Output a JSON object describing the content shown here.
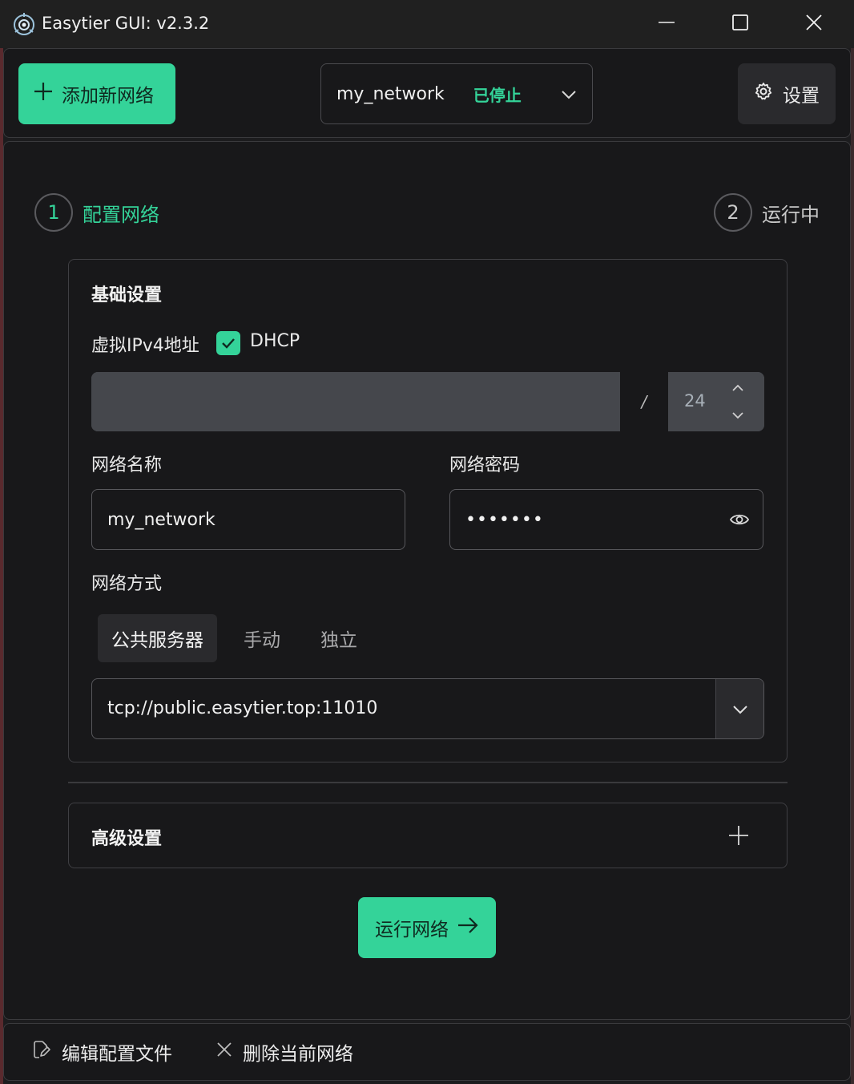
{
  "window": {
    "title": "Easytier GUI: v2.3.2",
    "controls": [
      "minimize-icon",
      "maximize-icon",
      "close-icon"
    ]
  },
  "toolbar": {
    "add_network_label": "添加新网络",
    "network_name": "my_network",
    "network_status": "已停止",
    "settings_label": "设置"
  },
  "steps": [
    {
      "number": "1",
      "label": "配置网络",
      "active": true
    },
    {
      "number": "2",
      "label": "运行中",
      "active": false
    }
  ],
  "basic": {
    "title": "基础设置",
    "virtual_ipv4_label": "虚拟IPv4地址",
    "dhcp_label": "DHCP",
    "dhcp_checked": true,
    "ipv4_value": "",
    "prefix_separator": "/",
    "prefix_value": "24",
    "network_name_label": "网络名称",
    "network_name_value": "my_network",
    "network_secret_label": "网络密码",
    "network_secret_value": "•••••••",
    "network_mode_label": "网络方式",
    "modes": [
      "公共服务器",
      "手动",
      "独立"
    ],
    "selected_mode": "公共服务器",
    "public_server": "tcp://public.easytier.top:11010"
  },
  "advanced": {
    "title": "高级设置"
  },
  "run_button_label": "运行网络",
  "footer": {
    "edit_config_label": "编辑配置文件",
    "delete_network_label": "删除当前网络"
  },
  "colors": {
    "accent": "#34d399",
    "background": "#18181a",
    "titlebar": "#202020"
  }
}
